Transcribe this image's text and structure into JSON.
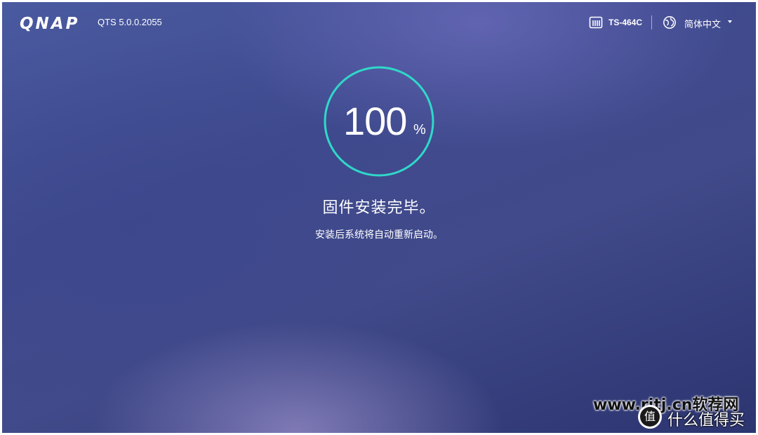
{
  "header": {
    "logo": "QNAP",
    "version": "QTS 5.0.0.2055",
    "device_icon": "nas-device-icon",
    "device_name": "TS-464C",
    "language_icon": "globe-icon",
    "language": "简体中文",
    "language_dropdown_icon": "caret-down-icon"
  },
  "progress": {
    "value": "100",
    "unit": "%",
    "fraction": 1.0,
    "ring_color": "#2fd8c8"
  },
  "status": {
    "title": "固件安装完毕。",
    "subtitle": "安装后系统将自动重新启动。"
  },
  "watermark": {
    "site": "www.rjtj.cn软荐网",
    "badge": "值",
    "text": "什么值得买"
  }
}
